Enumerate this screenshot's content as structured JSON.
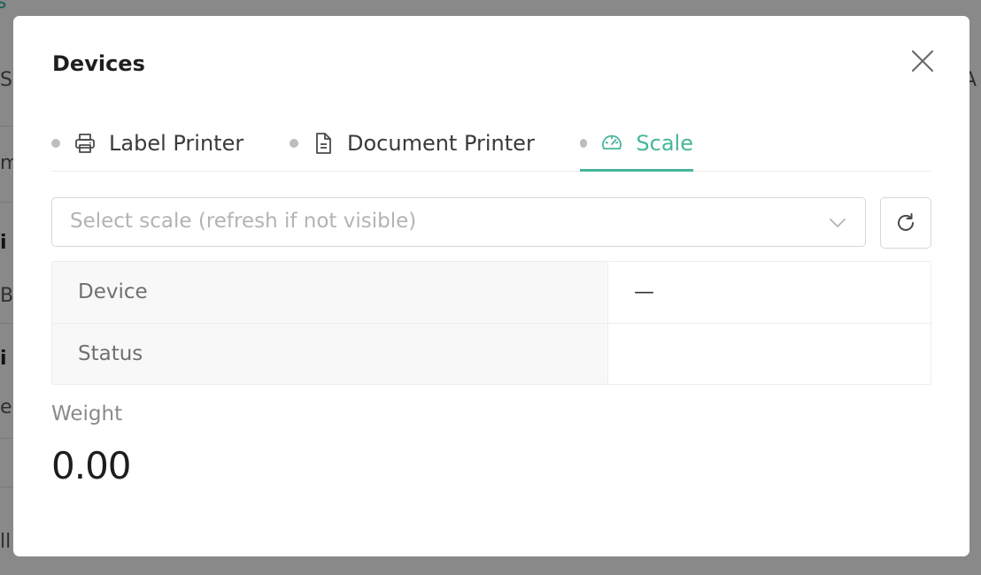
{
  "modal": {
    "title": "Devices"
  },
  "tabs": [
    {
      "label": "Label Printer",
      "icon": "printer-icon",
      "active": false
    },
    {
      "label": "Document Printer",
      "icon": "document-icon",
      "active": false
    },
    {
      "label": "Scale",
      "icon": "gauge-icon",
      "active": true
    }
  ],
  "scale_select": {
    "placeholder": "Select scale (refresh if not visible)"
  },
  "info_table": {
    "rows": [
      {
        "label": "Device",
        "value": "—"
      },
      {
        "label": "Status",
        "value": ""
      }
    ]
  },
  "weight": {
    "label": "Weight",
    "value": "0.00"
  },
  "colors": {
    "accent": "#46b59c",
    "overlay": "rgba(0,0,0,0.45)"
  }
}
